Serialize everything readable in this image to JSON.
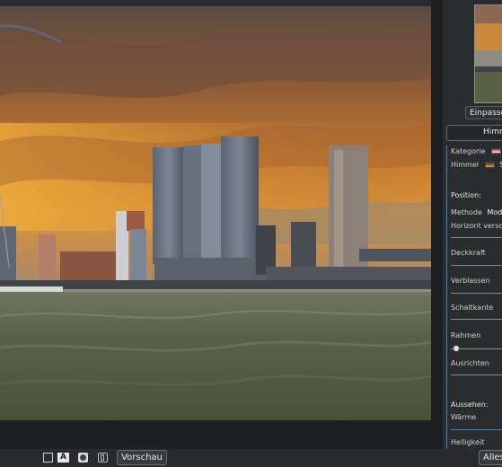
{
  "panel": {
    "fit_button_label": "Einpassen",
    "section_tab_label": "Himm",
    "category_label": "Kategorie",
    "sky_label": "Himmel",
    "sky_value": "Se",
    "position_label": "Position:",
    "method_label": "Methode",
    "method_value": "Mode",
    "horizon_label": "Horizont versch",
    "opacity_label": "Deckkraft",
    "fade_label": "Verblassen",
    "edge_label": "Schaltkante",
    "frame_label": "Rahmen",
    "align_label": "Ausrichten",
    "appearance_label": "Aussehen:",
    "warmth_label": "Wärme",
    "brightness_label": "Helligkeit"
  },
  "bottombar": {
    "preview_label": "Vorschau",
    "all_label": "Alles"
  },
  "icons": [
    "square-icon",
    "text-a-icon",
    "circle-mask-icon",
    "compare-icon"
  ],
  "colors": {
    "accent": "#3d86c6",
    "panel_bg": "#2b2c2f",
    "window_bg": "#1e1f21"
  }
}
